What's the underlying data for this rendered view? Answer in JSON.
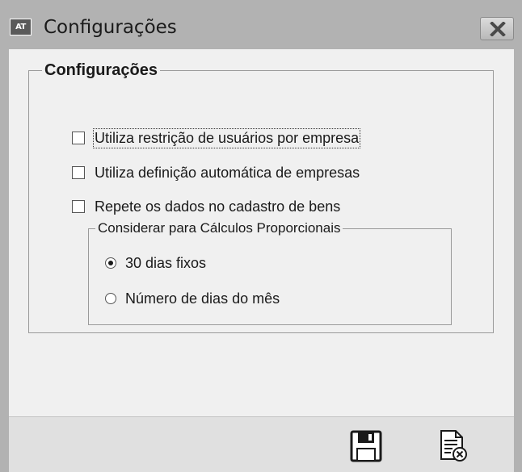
{
  "window": {
    "app_badge": "AT",
    "title": "Configurações",
    "close_icon": "close-x-icon"
  },
  "group": {
    "title": "Configurações",
    "checkboxes": [
      {
        "label": "Utiliza restrição de usuários por empresa",
        "checked": false,
        "focused": true
      },
      {
        "label": "Utiliza definição automática de empresas",
        "checked": false
      },
      {
        "label": "Repete os dados no cadastro de bens",
        "checked": false
      }
    ],
    "proportional": {
      "title": "Considerar para Cálculos Proporcionais",
      "options": [
        {
          "label": "30 dias fixos",
          "selected": true
        },
        {
          "label": "Número de dias do mês",
          "selected": false
        }
      ]
    }
  },
  "footer": {
    "save_icon": "floppy-disk-icon",
    "cancel_icon": "document-cancel-icon"
  },
  "colors": {
    "titlebar": "#b2b2b2",
    "client": "#f0f0f0",
    "footer": "#e0e0e0"
  }
}
